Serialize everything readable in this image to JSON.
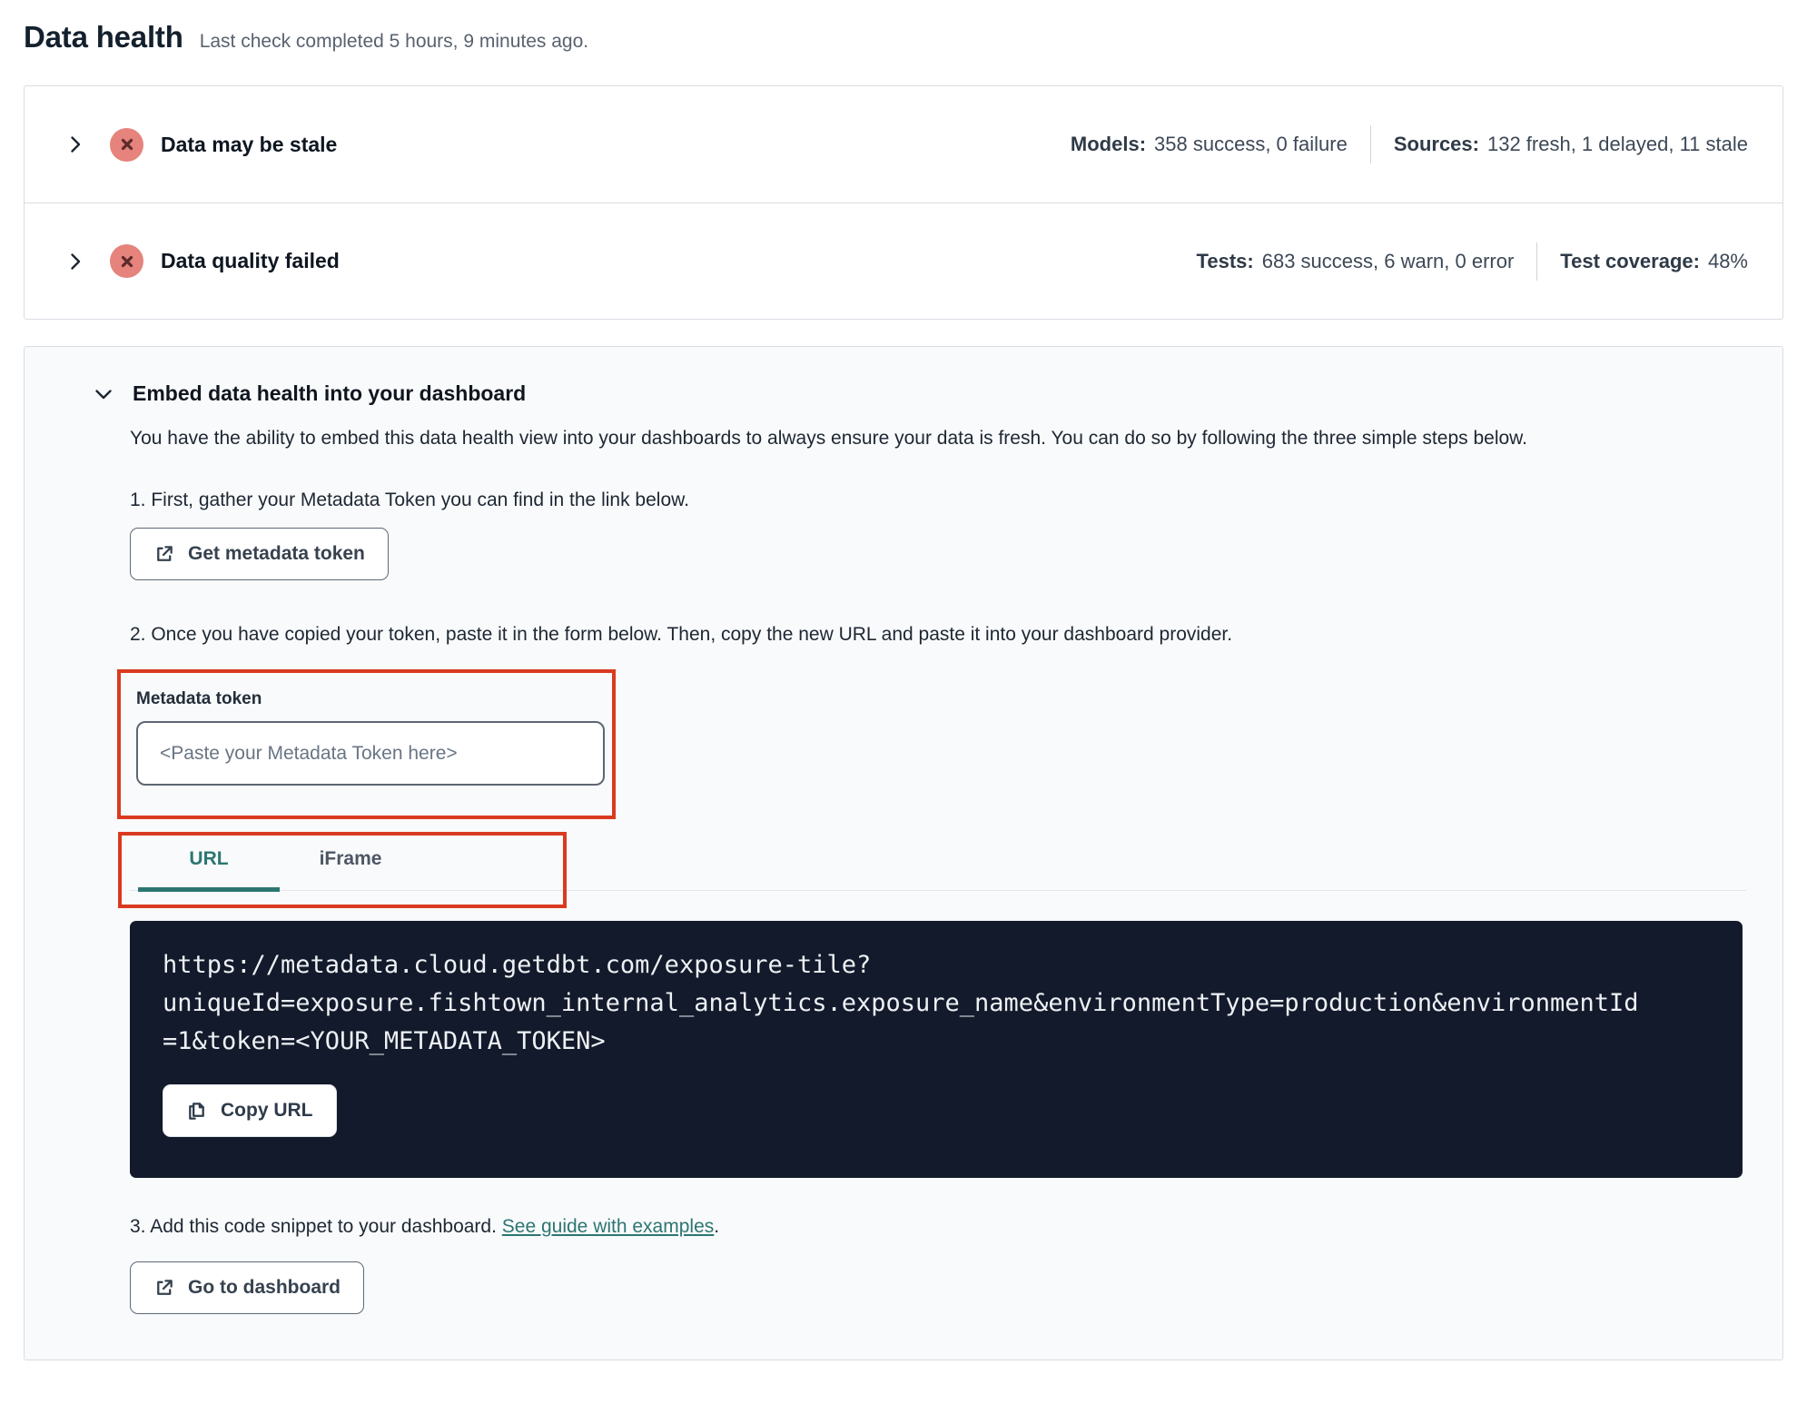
{
  "page": {
    "title": "Data health",
    "subtitle": "Last check completed 5 hours, 9 minutes ago."
  },
  "status_rows": [
    {
      "title": "Data may be stale",
      "status_icon": "error-x-circle",
      "stats": [
        {
          "label": "Models:",
          "value": "358 success, 0 failure"
        },
        {
          "label": "Sources:",
          "value": "132 fresh, 1 delayed, 11 stale"
        }
      ]
    },
    {
      "title": "Data quality failed",
      "status_icon": "error-x-circle",
      "stats": [
        {
          "label": "Tests:",
          "value": "683 success, 6 warn, 0 error"
        },
        {
          "label": "Test coverage:",
          "value": "48%"
        }
      ]
    }
  ],
  "embed_panel": {
    "title": "Embed data health into your dashboard",
    "description": "You have the ability to embed this data health view into your dashboards to always ensure your data is fresh. You can do so by following the three simple steps below.",
    "step1": {
      "text": "1. First, gather your Metadata Token you can find in the link below.",
      "button_label": "Get metadata token",
      "button_icon": "external-link-icon"
    },
    "step2": {
      "text": "2. Once you have copied your token, paste it in the form below. Then, copy the new URL and paste it into your dashboard provider.",
      "token_field": {
        "label": "Metadata token",
        "placeholder": "<Paste your Metadata Token here>",
        "value": ""
      },
      "tabs": [
        {
          "label": "URL",
          "active": true
        },
        {
          "label": "iFrame",
          "active": false
        }
      ],
      "code_block": {
        "url_full": "https://metadata.cloud.getdbt.com/exposure-tile?uniqueId=exposure.fishtown_internal_analytics.exposure_name&environmentType=production&environmentId=1&token=<YOUR_METADATA_TOKEN>",
        "url_lines": {
          "line1": "https://metadata.cloud.getdbt.com/exposure-tile?",
          "line2": "uniqueId=exposure.fishtown_internal_analytics.exposure_name&environmentType=production&environmentId",
          "line3": "=1&token=<YOUR_METADATA_TOKEN>"
        },
        "copy_button_label": "Copy URL",
        "copy_button_icon": "copy-icon"
      }
    },
    "step3": {
      "text_before_link": "3. Add this code snippet to your dashboard. ",
      "link_text": "See guide with examples",
      "text_after_link": ".",
      "button_label": "Go to dashboard",
      "button_icon": "external-link-icon"
    }
  },
  "colors": {
    "accent_teal": "#2c7672",
    "error_icon_bg": "#e5837c",
    "error_icon_x": "#5d2a2c",
    "annotation_red": "#d93a20",
    "code_block_bg": "#131a2b",
    "panel_bg": "#f9fafb"
  }
}
